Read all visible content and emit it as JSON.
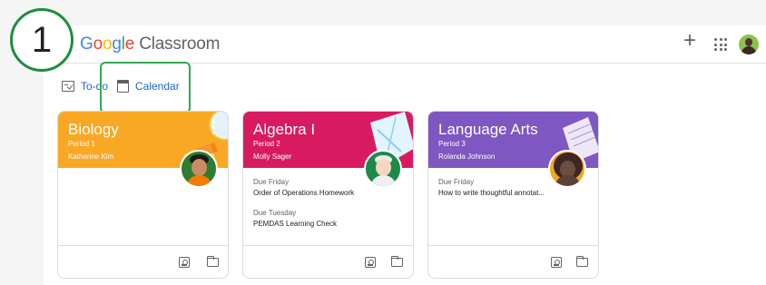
{
  "step": {
    "number": "1"
  },
  "header": {
    "brand": {
      "part1": "G",
      "part2": "o",
      "part3": "o",
      "part4": "g",
      "part5": "l",
      "part6": "e",
      "rest": " Classroom"
    },
    "add_symbol": "+",
    "icons": [
      "plus-icon",
      "apps-grid-icon",
      "user-avatar"
    ]
  },
  "nav": {
    "todo_label": "To-do",
    "calendar_label": "Calendar"
  },
  "highlight_color": "#34a853",
  "cards": [
    {
      "title": "Biology",
      "period": "Period 1",
      "teacher": "Katherine Kim",
      "banner_color": "#f9a825",
      "assignments": []
    },
    {
      "title": "Algebra I",
      "period": "Period 2",
      "teacher": "Molly Sager",
      "banner_color": "#d81b60",
      "assignments": [
        {
          "due": "Due Friday",
          "name": "Order of Operations Homework"
        },
        {
          "due": "Due Tuesday",
          "name": "PEMDAS Learning Check"
        }
      ]
    },
    {
      "title": "Language Arts",
      "period": "Period 3",
      "teacher": "Rolanda Johnson",
      "banner_color": "#7e57c2",
      "assignments": [
        {
          "due": "Due Friday",
          "name": "How to write thoughtful annotat..."
        }
      ]
    }
  ]
}
